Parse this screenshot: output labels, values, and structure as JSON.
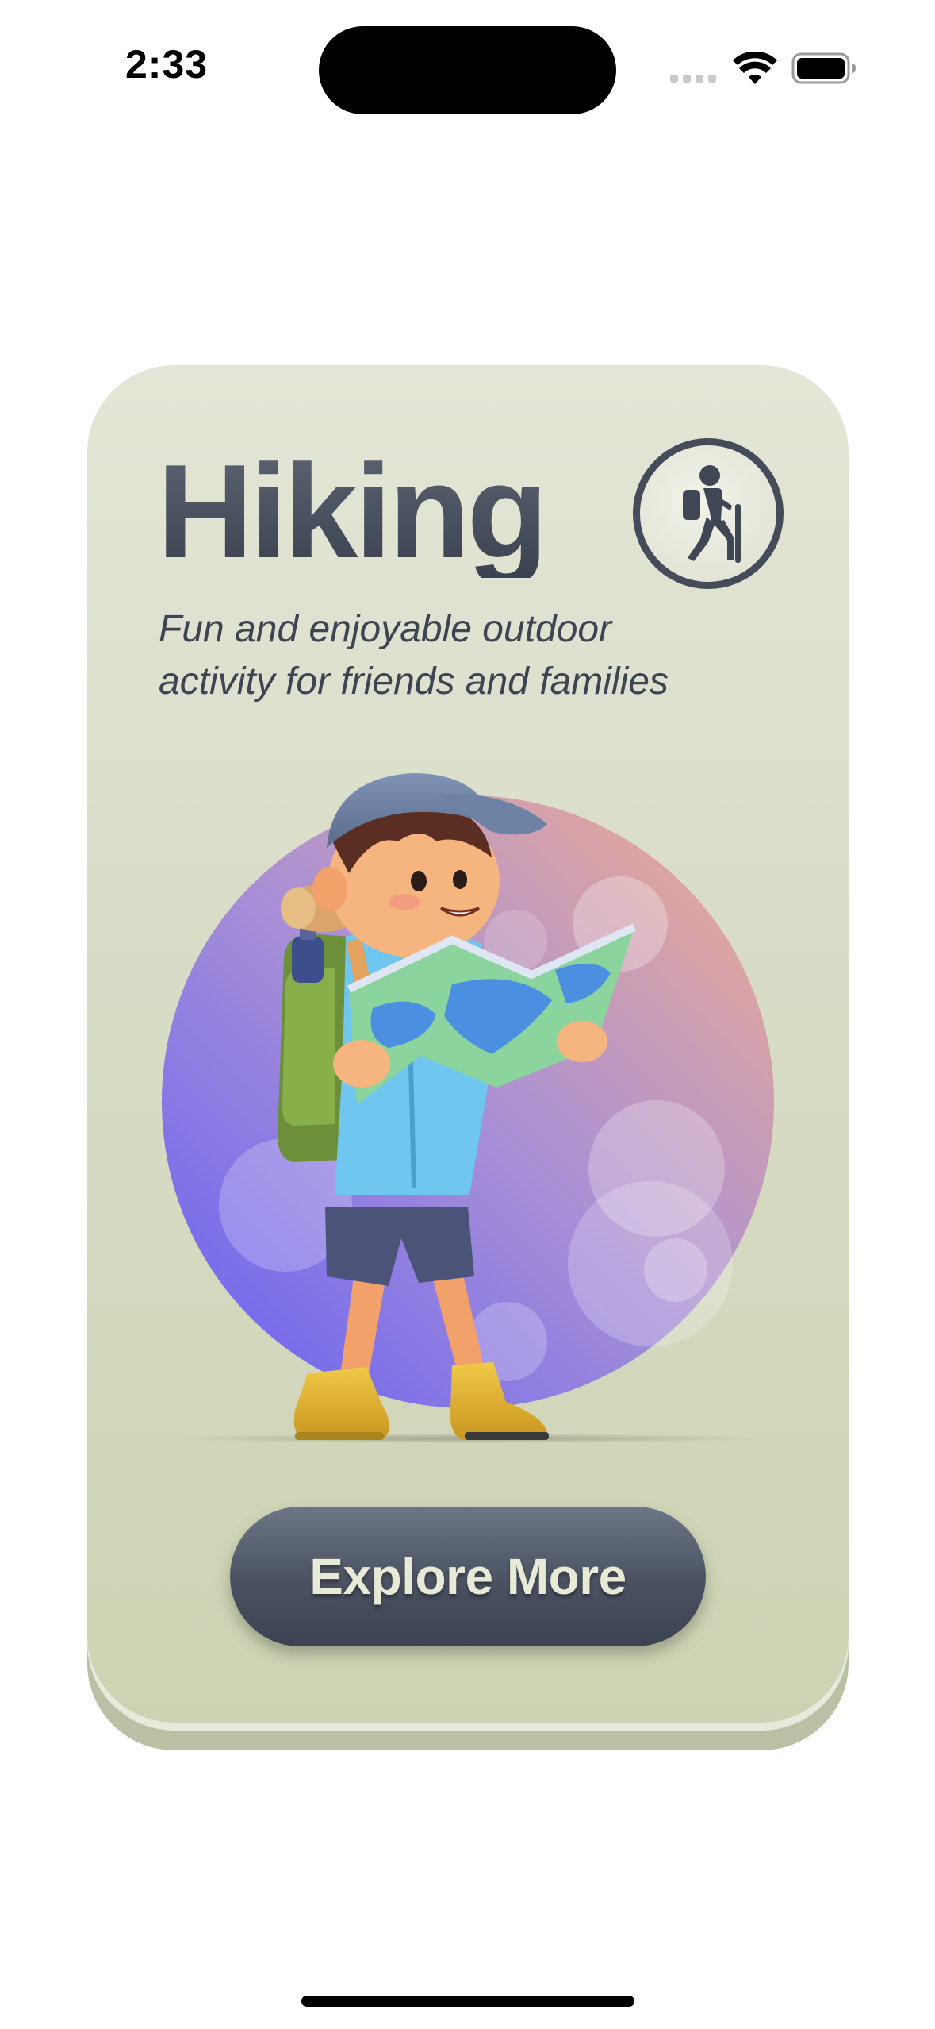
{
  "status_bar": {
    "time": "2:33",
    "icons": [
      "cellular-signal-icon",
      "wifi-icon",
      "battery-icon"
    ]
  },
  "card": {
    "title": "Hiking",
    "badge_icon": "hiker-icon",
    "subtitle_lines": [
      "Fun and enjoyable outdoor",
      "activity for friends and families"
    ],
    "illustration": "boy-hiker-reading-map",
    "button_label": "Explore More"
  },
  "colors": {
    "card_background": "#dadeca",
    "title": "#444c5a",
    "button": "#4a5262",
    "button_text": "#e6ead6",
    "circle_gradient_start": "#6f6cf2",
    "circle_gradient_end": "#eeaf93"
  }
}
